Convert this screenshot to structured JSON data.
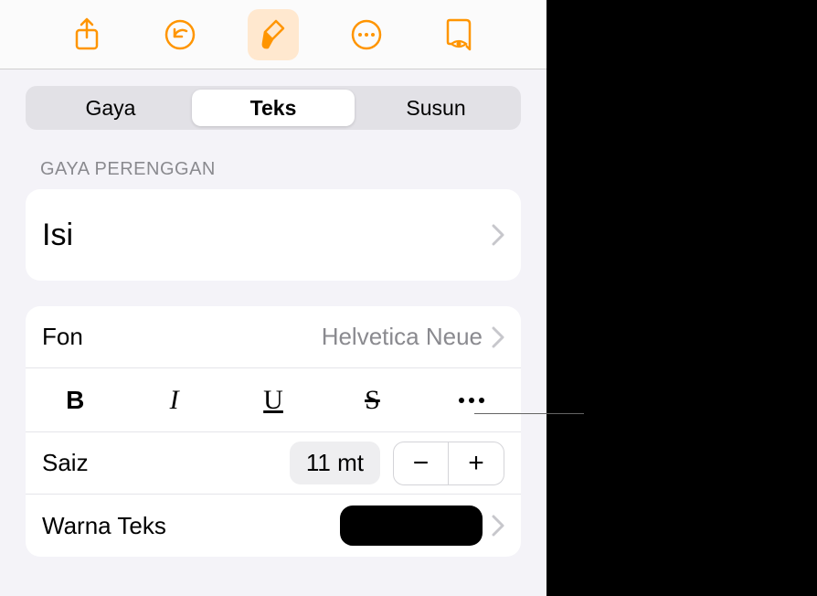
{
  "toolbar": {
    "share": "share-icon",
    "undo": "undo-icon",
    "format": "format-brush-icon",
    "more": "more-icon",
    "readmode": "reading-mode-icon"
  },
  "tabs": {
    "style": "Gaya",
    "text": "Teks",
    "arrange": "Susun"
  },
  "section": {
    "paragraph_style_label": "GAYA PERENGGAN",
    "paragraph_style_value": "Isi"
  },
  "font": {
    "label": "Fon",
    "value": "Helvetica Neue"
  },
  "styles": {
    "bold": "B",
    "italic": "I",
    "underline": "U",
    "strike": "S"
  },
  "size": {
    "label": "Saiz",
    "value": "11 mt"
  },
  "textcolor": {
    "label": "Warna Teks",
    "value": "#000000"
  }
}
